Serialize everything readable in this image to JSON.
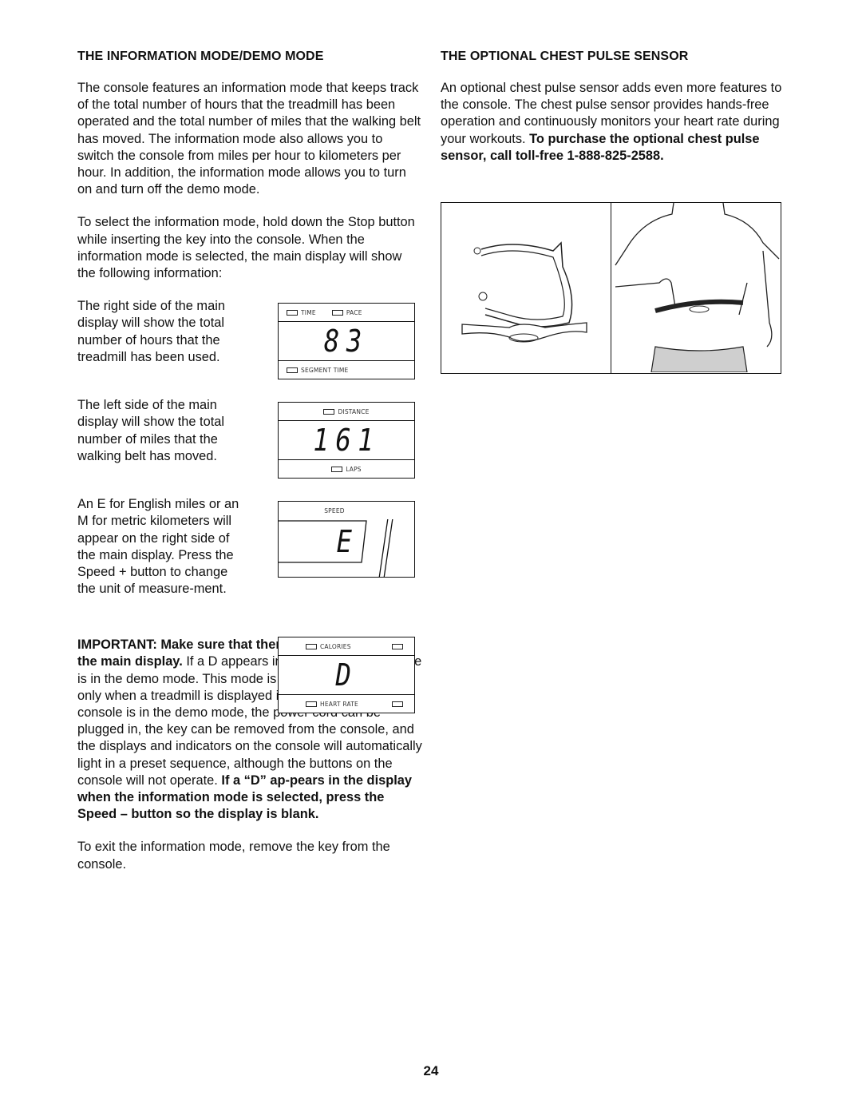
{
  "page_number": "24",
  "left": {
    "heading": "THE INFORMATION MODE/DEMO MODE",
    "intro": "The console features an information mode that keeps track of the total number of hours that the treadmill has been operated and the total number of miles that the walking belt has moved. The information mode also allows you to switch the console from miles per hour to kilometers per hour. In addition, the information mode allows you to turn on and turn off the demo mode.",
    "select_text": "To select the information mode, hold down the Stop button while inserting the key into the console. When the information mode is selected, the main display will show the following information:",
    "hours_text": "The right side of the main display will show the total number of hours that the treadmill has been used.",
    "miles_text": "The left side of the main display will show the total number of miles that the walking belt has moved.",
    "units_text": "An  E  for English miles or an  M  for metric kilometers will appear on the right side of the main display. Press the Speed + button to change the unit of measure-ment.",
    "important_bold": "IMPORTANT: Make sure that there is not a letter “D” in the main display.",
    "important_rest": " If a  D  appears in the display, the console is in the  demo mode. This mode is intended to be used only when a treadmill is displayed in a store. When the console is in the demo mode, the power cord can be plugged in, the key can be removed from the console, and the displays and indicators on the console will automatically light in a preset sequence, although the buttons on the console will not operate. ",
    "important_bold2": "If a “D” ap-pears in the display when the information mode is selected, press the Speed – button so the display is blank.",
    "exit_text": "To exit the information mode, remove the key from the console."
  },
  "displays": {
    "hours": {
      "top_labels": [
        "TIME",
        "PACE"
      ],
      "value": "83",
      "bottom_label": "SEGMENT TIME"
    },
    "miles": {
      "top_label": "DISTANCE",
      "value": "161",
      "bottom_label": "LAPS"
    },
    "units": {
      "top_label": "SPEED",
      "value": "E"
    },
    "demo": {
      "top_label": "CALORIES",
      "value": "D",
      "bottom_label": "HEART RATE"
    }
  },
  "right": {
    "heading": "THE OPTIONAL CHEST PULSE SENSOR",
    "body": "An optional chest pulse sensor adds even more features to the console. The chest pulse sensor provides hands-free operation and continuously monitors your heart rate during your workouts. ",
    "body_bold": "To purchase the optional chest pulse sensor, call toll-free 1-888-825-2588."
  },
  "figure": {
    "left_panel": "chest-strap-and-sensor-illustration",
    "right_panel": "person-wearing-chest-sensor-illustration"
  }
}
